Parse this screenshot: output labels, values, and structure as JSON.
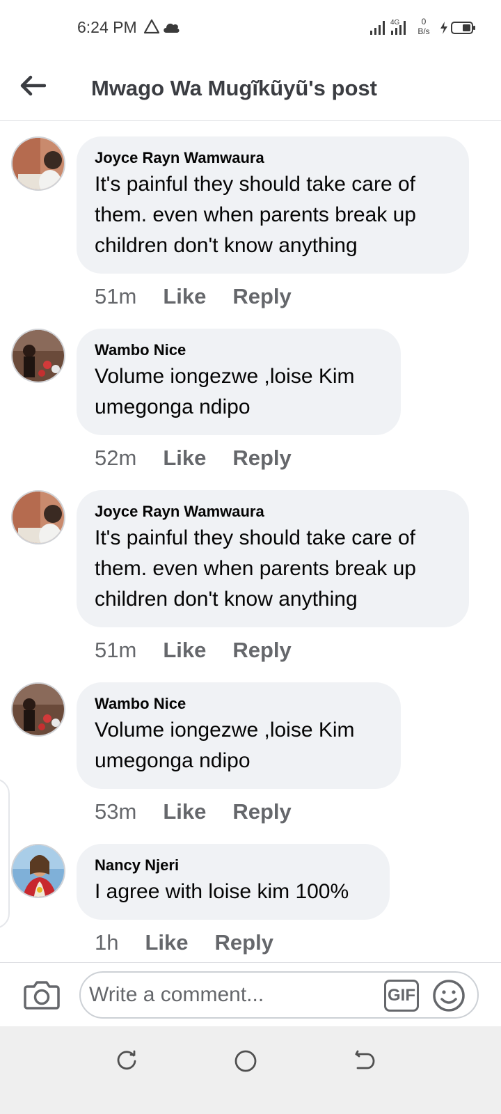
{
  "status_bar": {
    "time": "6:24 PM",
    "net_speed_value": "0",
    "net_speed_unit": "B/s",
    "network_label": "4G",
    "icons": [
      "warning-icon",
      "cloud-icon",
      "signal-icon",
      "charging-icon",
      "battery-icon"
    ]
  },
  "header": {
    "title": "Mwago Wa Mugĩkũyũ's post",
    "back_icon": "arrow-left-icon"
  },
  "comments": [
    {
      "author": "Joyce Rayn Wamwaura",
      "text": "It's painful they should take care of them. even when parents break up children don't know anything",
      "time": "51m",
      "like_label": "Like",
      "reply_label": "Reply"
    },
    {
      "author": "Wambo Nice",
      "text": "Volume iongezwe ,loise Kim umegonga ndipo",
      "time": "52m",
      "like_label": "Like",
      "reply_label": "Reply"
    },
    {
      "author": "Joyce Rayn Wamwaura",
      "text": "It's painful they should take care of them. even when parents break up children don't know anything",
      "time": "51m",
      "like_label": "Like",
      "reply_label": "Reply"
    },
    {
      "author": "Wambo Nice",
      "text": "Volume iongezwe ,loise Kim umegonga ndipo",
      "time": "53m",
      "like_label": "Like",
      "reply_label": "Reply"
    },
    {
      "author": "Nancy Njeri",
      "text": "I agree with loise kim 100%",
      "time": "1h",
      "like_label": "Like",
      "reply_label": "Reply"
    }
  ],
  "composer": {
    "placeholder": "Write a comment...",
    "gif_label": "GIF",
    "camera_icon": "camera-icon",
    "emoji_icon": "smiley-icon"
  },
  "nav_bar": {
    "icons": [
      "recent-apps-icon",
      "home-icon",
      "back-nav-icon"
    ]
  }
}
